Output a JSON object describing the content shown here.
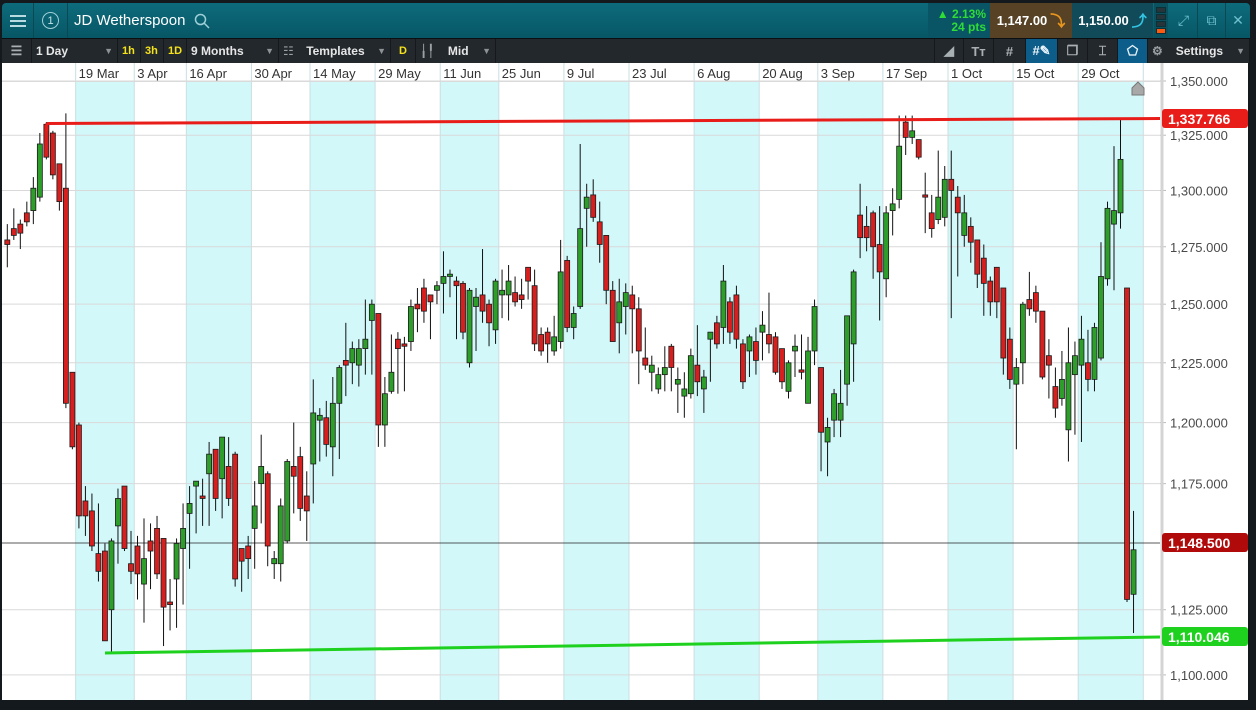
{
  "header": {
    "instrument": "JD Wetherspoon",
    "watchlist_number": "1",
    "change_pct": "▲ 2.13%",
    "change_pts": "24 pts",
    "sell_price": "1,147.00",
    "buy_price": "1,150.00"
  },
  "toolbar": {
    "interval": "1 Day",
    "quick_1h": "1h",
    "quick_3h": "3h",
    "quick_1d": "1D",
    "range": "9 Months",
    "templates": "Templates",
    "d_button": "D",
    "price_type": "Mid",
    "settings": "Settings"
  },
  "colors": {
    "up": "#2e9e2a",
    "down": "#d61f1f",
    "band": "#d3f8fa",
    "resistance": "#e81d1a",
    "support": "#1fd11f",
    "last_price": "#b00a0a"
  },
  "chart_data": {
    "type": "candlestick",
    "title": "JD Wetherspoon",
    "y_scale": "log",
    "ylim": [
      1097,
      1352
    ],
    "y_ticks": [
      1350,
      1325,
      1300,
      1275,
      1250,
      1225,
      1200,
      1175,
      1125,
      1100
    ],
    "y_tick_labels": [
      "1,350.000",
      "1,325.000",
      "1,300.000",
      "1,275.000",
      "1,250.000",
      "1,225.000",
      "1,200.000",
      "1,175.000",
      "1,125.000",
      "1,100.000"
    ],
    "x_labels": [
      {
        "label": "19 Mar",
        "index": 11
      },
      {
        "label": "3 Apr",
        "index": 20
      },
      {
        "label": "16 Apr",
        "index": 28
      },
      {
        "label": "30 Apr",
        "index": 38
      },
      {
        "label": "14 May",
        "index": 47
      },
      {
        "label": "29 May",
        "index": 57
      },
      {
        "label": "11 Jun",
        "index": 67
      },
      {
        "label": "25 Jun",
        "index": 76
      },
      {
        "label": "9 Jul",
        "index": 86
      },
      {
        "label": "23 Jul",
        "index": 96
      },
      {
        "label": "6 Aug",
        "index": 106
      },
      {
        "label": "20 Aug",
        "index": 116
      },
      {
        "label": "3 Sep",
        "index": 125
      },
      {
        "label": "17 Sep",
        "index": 135
      },
      {
        "label": "1 Oct",
        "index": 145
      },
      {
        "label": "15 Oct",
        "index": 155
      },
      {
        "label": "29 Oct",
        "index": 165
      }
    ],
    "ohlc_fields": [
      "open",
      "high",
      "low",
      "close"
    ],
    "candles": [
      [
        1278,
        1285,
        1266,
        1276
      ],
      [
        1283,
        1292,
        1278,
        1280
      ],
      [
        1285,
        1287,
        1274,
        1281
      ],
      [
        1290,
        1295,
        1284,
        1286
      ],
      [
        1291,
        1306,
        1285,
        1301
      ],
      [
        1297,
        1326,
        1295,
        1321
      ],
      [
        1330,
        1331,
        1314,
        1315
      ],
      [
        1326,
        1327,
        1305,
        1307
      ],
      [
        1312,
        1312,
        1291,
        1295
      ],
      [
        1301,
        1335,
        1206,
        1208
      ],
      [
        1221,
        1221,
        1189,
        1190
      ],
      [
        1199,
        1200,
        1157,
        1162
      ],
      [
        1168,
        1174,
        1154,
        1162
      ],
      [
        1164,
        1171,
        1148,
        1150
      ],
      [
        1147,
        1167,
        1136,
        1140
      ],
      [
        1148,
        1151,
        1113,
        1113
      ],
      [
        1125,
        1153,
        1108,
        1152
      ],
      [
        1158,
        1173,
        1143,
        1169
      ],
      [
        1174,
        1174,
        1148,
        1149
      ],
      [
        1143,
        1156,
        1135,
        1140
      ],
      [
        1150,
        1154,
        1129,
        1139
      ],
      [
        1135,
        1161,
        1120,
        1145
      ],
      [
        1152,
        1159,
        1133,
        1148
      ],
      [
        1157,
        1162,
        1137,
        1139
      ],
      [
        1153,
        1153,
        1111,
        1126
      ],
      [
        1128,
        1137,
        1117,
        1127
      ],
      [
        1137,
        1153,
        1118,
        1151
      ],
      [
        1149,
        1167,
        1127,
        1157
      ],
      [
        1163,
        1174,
        1141,
        1167
      ],
      [
        1174,
        1176,
        1155,
        1176
      ],
      [
        1170,
        1177,
        1158,
        1169
      ],
      [
        1179,
        1192,
        1158,
        1187
      ],
      [
        1189,
        1189,
        1164,
        1169
      ],
      [
        1177,
        1194,
        1161,
        1194
      ],
      [
        1182,
        1194,
        1166,
        1169
      ],
      [
        1187,
        1188,
        1134,
        1137
      ],
      [
        1149,
        1149,
        1132,
        1144
      ],
      [
        1150,
        1154,
        1137,
        1145
      ],
      [
        1157,
        1176,
        1141,
        1166
      ],
      [
        1175,
        1195,
        1159,
        1182
      ],
      [
        1179,
        1180,
        1142,
        1150
      ],
      [
        1143,
        1148,
        1137,
        1145
      ],
      [
        1143,
        1169,
        1136,
        1166
      ],
      [
        1152,
        1185,
        1151,
        1184
      ],
      [
        1182,
        1200,
        1163,
        1178
      ],
      [
        1186,
        1190,
        1160,
        1165
      ],
      [
        1170,
        1180,
        1152,
        1164
      ],
      [
        1183,
        1218,
        1167,
        1204
      ],
      [
        1201,
        1206,
        1184,
        1203
      ],
      [
        1202,
        1209,
        1186,
        1191
      ],
      [
        1190,
        1219,
        1178,
        1208
      ],
      [
        1208,
        1224,
        1185,
        1223
      ],
      [
        1226,
        1242,
        1211,
        1224
      ],
      [
        1225,
        1234,
        1216,
        1231
      ],
      [
        1224,
        1235,
        1215,
        1231
      ],
      [
        1231,
        1252,
        1220,
        1235
      ],
      [
        1243,
        1252,
        1220,
        1250
      ],
      [
        1246,
        1246,
        1190,
        1199
      ],
      [
        1199,
        1219,
        1190,
        1212
      ],
      [
        1213,
        1237,
        1212,
        1221
      ],
      [
        1235,
        1238,
        1212,
        1231
      ],
      [
        1233,
        1236,
        1213,
        1232
      ],
      [
        1234,
        1252,
        1230,
        1249
      ],
      [
        1250,
        1257,
        1238,
        1248
      ],
      [
        1257,
        1261,
        1242,
        1247
      ],
      [
        1254,
        1254,
        1235,
        1251
      ],
      [
        1256,
        1260,
        1250,
        1258
      ],
      [
        1259,
        1273,
        1246,
        1262
      ],
      [
        1262,
        1265,
        1253,
        1263
      ],
      [
        1260,
        1262,
        1235,
        1258
      ],
      [
        1259,
        1260,
        1235,
        1238
      ],
      [
        1225,
        1257,
        1223,
        1256
      ],
      [
        1249,
        1257,
        1230,
        1253
      ],
      [
        1254,
        1274,
        1242,
        1247
      ],
      [
        1250,
        1252,
        1232,
        1242
      ],
      [
        1239,
        1261,
        1233,
        1260
      ],
      [
        1254,
        1265,
        1244,
        1256
      ],
      [
        1254,
        1267,
        1243,
        1260
      ],
      [
        1255,
        1262,
        1249,
        1251
      ],
      [
        1254,
        1261,
        1248,
        1252
      ],
      [
        1266,
        1266,
        1252,
        1260
      ],
      [
        1258,
        1265,
        1230,
        1233
      ],
      [
        1237,
        1240,
        1228,
        1230
      ],
      [
        1238,
        1240,
        1225,
        1233
      ],
      [
        1230,
        1245,
        1228,
        1236
      ],
      [
        1234,
        1278,
        1231,
        1264
      ],
      [
        1269,
        1271,
        1238,
        1240
      ],
      [
        1240,
        1249,
        1235,
        1246
      ],
      [
        1249,
        1321,
        1248,
        1283
      ],
      [
        1292,
        1303,
        1275,
        1297
      ],
      [
        1298,
        1305,
        1286,
        1288
      ],
      [
        1286,
        1295,
        1268,
        1276
      ],
      [
        1280,
        1280,
        1250,
        1256
      ],
      [
        1256,
        1260,
        1234,
        1234
      ],
      [
        1242,
        1261,
        1229,
        1251
      ],
      [
        1249,
        1259,
        1237,
        1255
      ],
      [
        1254,
        1258,
        1229,
        1248
      ],
      [
        1248,
        1253,
        1216,
        1230
      ],
      [
        1227,
        1240,
        1222,
        1224
      ],
      [
        1221,
        1228,
        1213,
        1224
      ],
      [
        1214,
        1223,
        1212,
        1220
      ],
      [
        1220,
        1232,
        1213,
        1223
      ],
      [
        1232,
        1233,
        1213,
        1223
      ],
      [
        1216,
        1223,
        1204,
        1218
      ],
      [
        1211,
        1221,
        1202,
        1214
      ],
      [
        1212,
        1231,
        1210,
        1228
      ],
      [
        1224,
        1241,
        1211,
        1217
      ],
      [
        1214,
        1222,
        1204,
        1219
      ],
      [
        1235,
        1238,
        1217,
        1238
      ],
      [
        1242,
        1245,
        1231,
        1233
      ],
      [
        1240,
        1267,
        1233,
        1260
      ],
      [
        1251,
        1253,
        1233,
        1238
      ],
      [
        1254,
        1258,
        1231,
        1235
      ],
      [
        1233,
        1235,
        1214,
        1217
      ],
      [
        1230,
        1237,
        1219,
        1236
      ],
      [
        1234,
        1240,
        1220,
        1226
      ],
      [
        1238,
        1247,
        1226,
        1241
      ],
      [
        1237,
        1255,
        1229,
        1233
      ],
      [
        1236,
        1238,
        1220,
        1221
      ],
      [
        1231,
        1231,
        1214,
        1217
      ],
      [
        1213,
        1226,
        1210,
        1225
      ],
      [
        1230,
        1237,
        1219,
        1232
      ],
      [
        1222,
        1237,
        1218,
        1221
      ],
      [
        1208,
        1236,
        1208,
        1230
      ],
      [
        1230,
        1252,
        1224,
        1249
      ],
      [
        1223,
        1223,
        1180,
        1196
      ],
      [
        1192,
        1202,
        1178,
        1198
      ],
      [
        1201,
        1214,
        1194,
        1212
      ],
      [
        1201,
        1222,
        1194,
        1208
      ],
      [
        1216,
        1245,
        1207,
        1245
      ],
      [
        1233,
        1265,
        1217,
        1264
      ],
      [
        1289,
        1303,
        1270,
        1279
      ],
      [
        1284,
        1293,
        1273,
        1279
      ],
      [
        1290,
        1291,
        1261,
        1275
      ],
      [
        1276,
        1293,
        1243,
        1264
      ],
      [
        1261,
        1293,
        1253,
        1290
      ],
      [
        1291,
        1301,
        1280,
        1294
      ],
      [
        1296,
        1334,
        1292,
        1320
      ],
      [
        1331,
        1334,
        1316,
        1324
      ],
      [
        1324,
        1334,
        1321,
        1327
      ],
      [
        1323,
        1323,
        1314,
        1315
      ],
      [
        1298,
        1308,
        1281,
        1297
      ],
      [
        1290,
        1298,
        1279,
        1283
      ],
      [
        1287,
        1318,
        1285,
        1297
      ],
      [
        1288,
        1311,
        1284,
        1305
      ],
      [
        1305,
        1318,
        1244,
        1300
      ],
      [
        1297,
        1302,
        1262,
        1290
      ],
      [
        1280,
        1298,
        1275,
        1290
      ],
      [
        1284,
        1288,
        1268,
        1277
      ],
      [
        1278,
        1278,
        1257,
        1263
      ],
      [
        1270,
        1276,
        1245,
        1259
      ],
      [
        1260,
        1262,
        1245,
        1251
      ],
      [
        1266,
        1266,
        1244,
        1251
      ],
      [
        1257,
        1257,
        1220,
        1227
      ],
      [
        1235,
        1240,
        1214,
        1218
      ],
      [
        1216,
        1227,
        1189,
        1223
      ],
      [
        1225,
        1251,
        1216,
        1250
      ],
      [
        1252,
        1264,
        1245,
        1248
      ],
      [
        1255,
        1258,
        1242,
        1247
      ],
      [
        1247,
        1247,
        1218,
        1219
      ],
      [
        1228,
        1235,
        1210,
        1224
      ],
      [
        1215,
        1223,
        1202,
        1206
      ],
      [
        1210,
        1230,
        1207,
        1218
      ],
      [
        1197,
        1240,
        1184,
        1225
      ],
      [
        1220,
        1234,
        1195,
        1228
      ],
      [
        1224,
        1245,
        1192,
        1235
      ],
      [
        1225,
        1239,
        1213,
        1218
      ],
      [
        1218,
        1242,
        1213,
        1240
      ],
      [
        1227,
        1277,
        1226,
        1262
      ],
      [
        1261,
        1295,
        1258,
        1292
      ],
      [
        1285,
        1320,
        1256,
        1291
      ],
      [
        1290,
        1332,
        1283,
        1314
      ],
      [
        1257,
        1257,
        1128,
        1129
      ],
      [
        1131,
        1164,
        1116,
        1148.5
      ]
    ],
    "last_price": 1148.5,
    "last_price_label": "1,148.500",
    "resistance_line": {
      "value": 1337.766,
      "label": "1,337.766"
    },
    "support_line": {
      "value": 1110.046,
      "label": "1,110.046"
    },
    "grid": true
  }
}
